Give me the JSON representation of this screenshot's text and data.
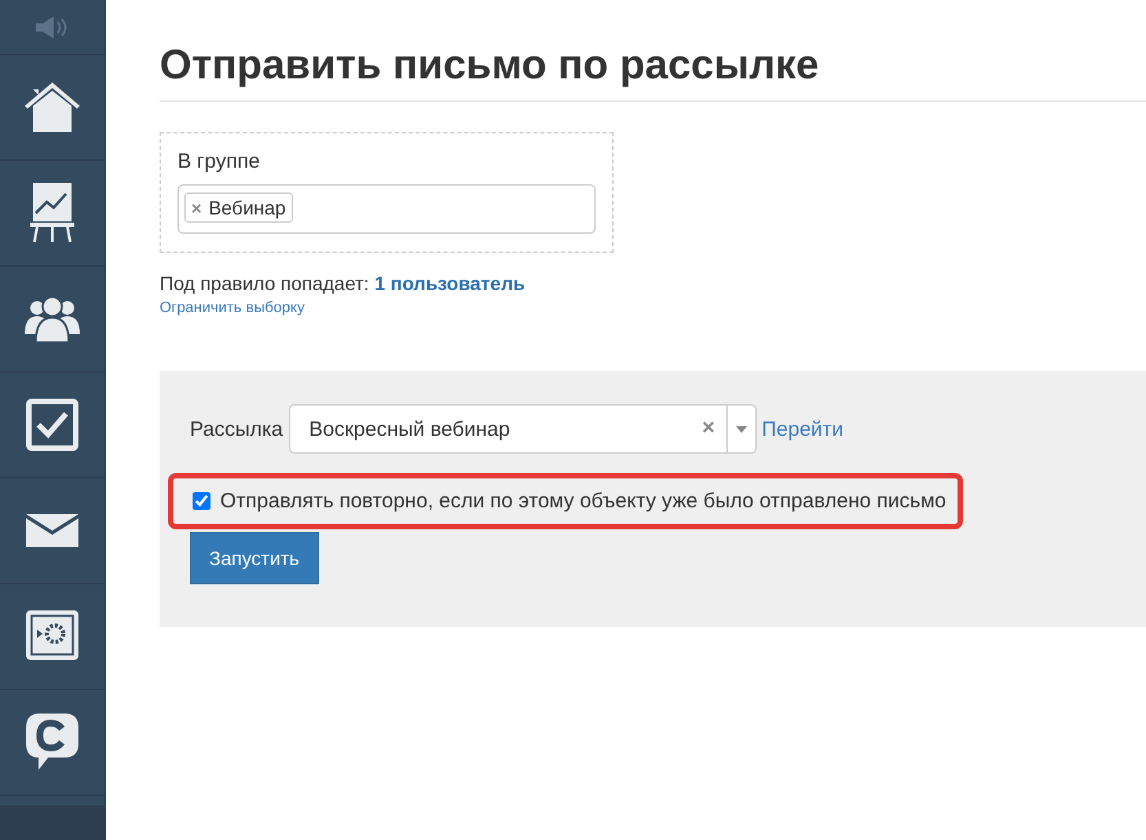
{
  "sidebar": {
    "items": [
      {
        "kind": "speaker"
      },
      {
        "kind": "home"
      },
      {
        "kind": "chart"
      },
      {
        "kind": "users"
      },
      {
        "kind": "tasks"
      },
      {
        "kind": "mail"
      },
      {
        "kind": "safe"
      },
      {
        "kind": "chat"
      }
    ]
  },
  "title": "Отправить письмо по рассылке",
  "group_filter": {
    "label": "В группе",
    "tags": [
      {
        "remove": "×",
        "label": "Вебинар"
      }
    ]
  },
  "rule_summary": {
    "prefix": "Под правило попадает:",
    "count": "1 пользователь",
    "limit_link": "Ограничить выборку"
  },
  "mailing": {
    "label": "Рассылка",
    "value": "Воскресный вебинар",
    "clear": "×",
    "go_link": "Перейти"
  },
  "resend": {
    "label": "Отправлять повторно, если по этому объекту уже было отправлено письмо",
    "checked": true,
    "highlighted": true
  },
  "buttons": [
    "Запустить"
  ]
}
